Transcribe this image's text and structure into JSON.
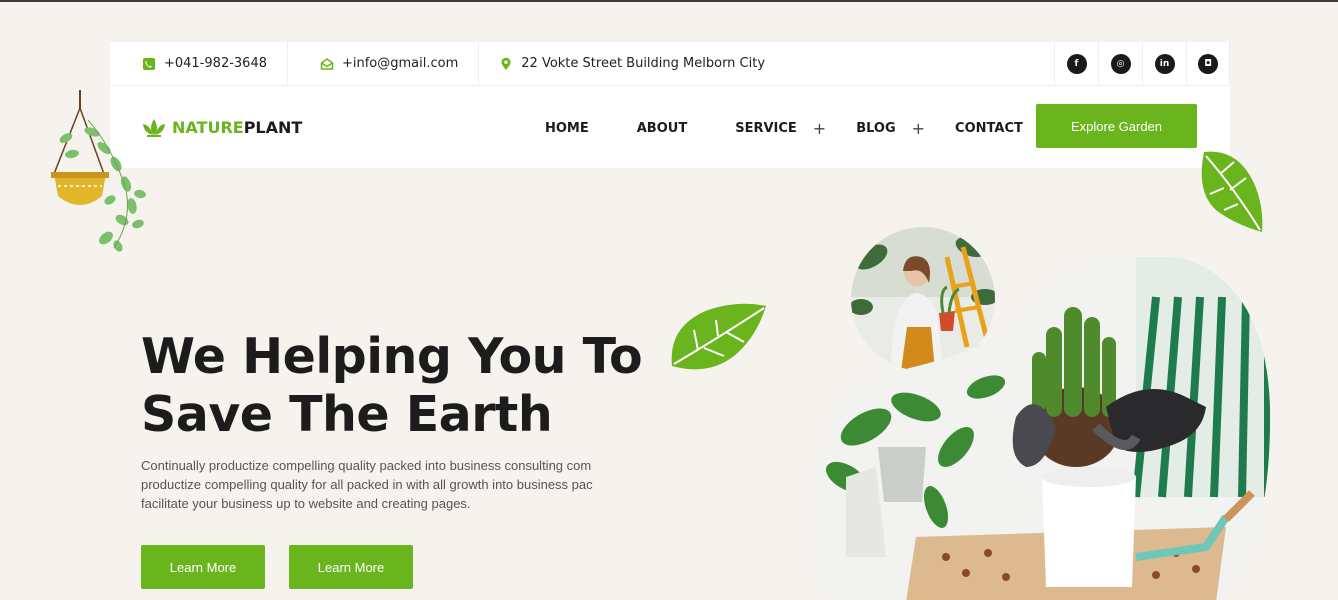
{
  "topbar": {
    "phone": "+041-982-3648",
    "email": "+info@gmail.com",
    "address": "22 Vokte Street Building Melborn City",
    "socials": [
      "facebook-icon",
      "dribbble-icon",
      "linkedin-icon",
      "instagram-icon"
    ]
  },
  "brand": {
    "part1": "NATURE",
    "part2": "PLANT"
  },
  "nav": {
    "home": "HOME",
    "about": "ABOUT",
    "service": "SERVICE",
    "blog": "BLOG",
    "contact": "CONTACT",
    "plus": "+"
  },
  "cta": {
    "explore": "Explore Garden"
  },
  "hero": {
    "title_line1": "We Helping You To",
    "title_line2": "Save The Earth",
    "text_line1": "Continually productize compelling quality packed into business consulting com",
    "text_line2": "productize compelling quality for all packed in with all growth into business pac",
    "text_line3": "facilitate your business up to website and creating pages.",
    "btn1": "Learn More",
    "btn2": "Learn More"
  },
  "colors": {
    "accent": "#6ab41e",
    "background": "#f6f3ef",
    "dark": "#1c1c1c"
  }
}
